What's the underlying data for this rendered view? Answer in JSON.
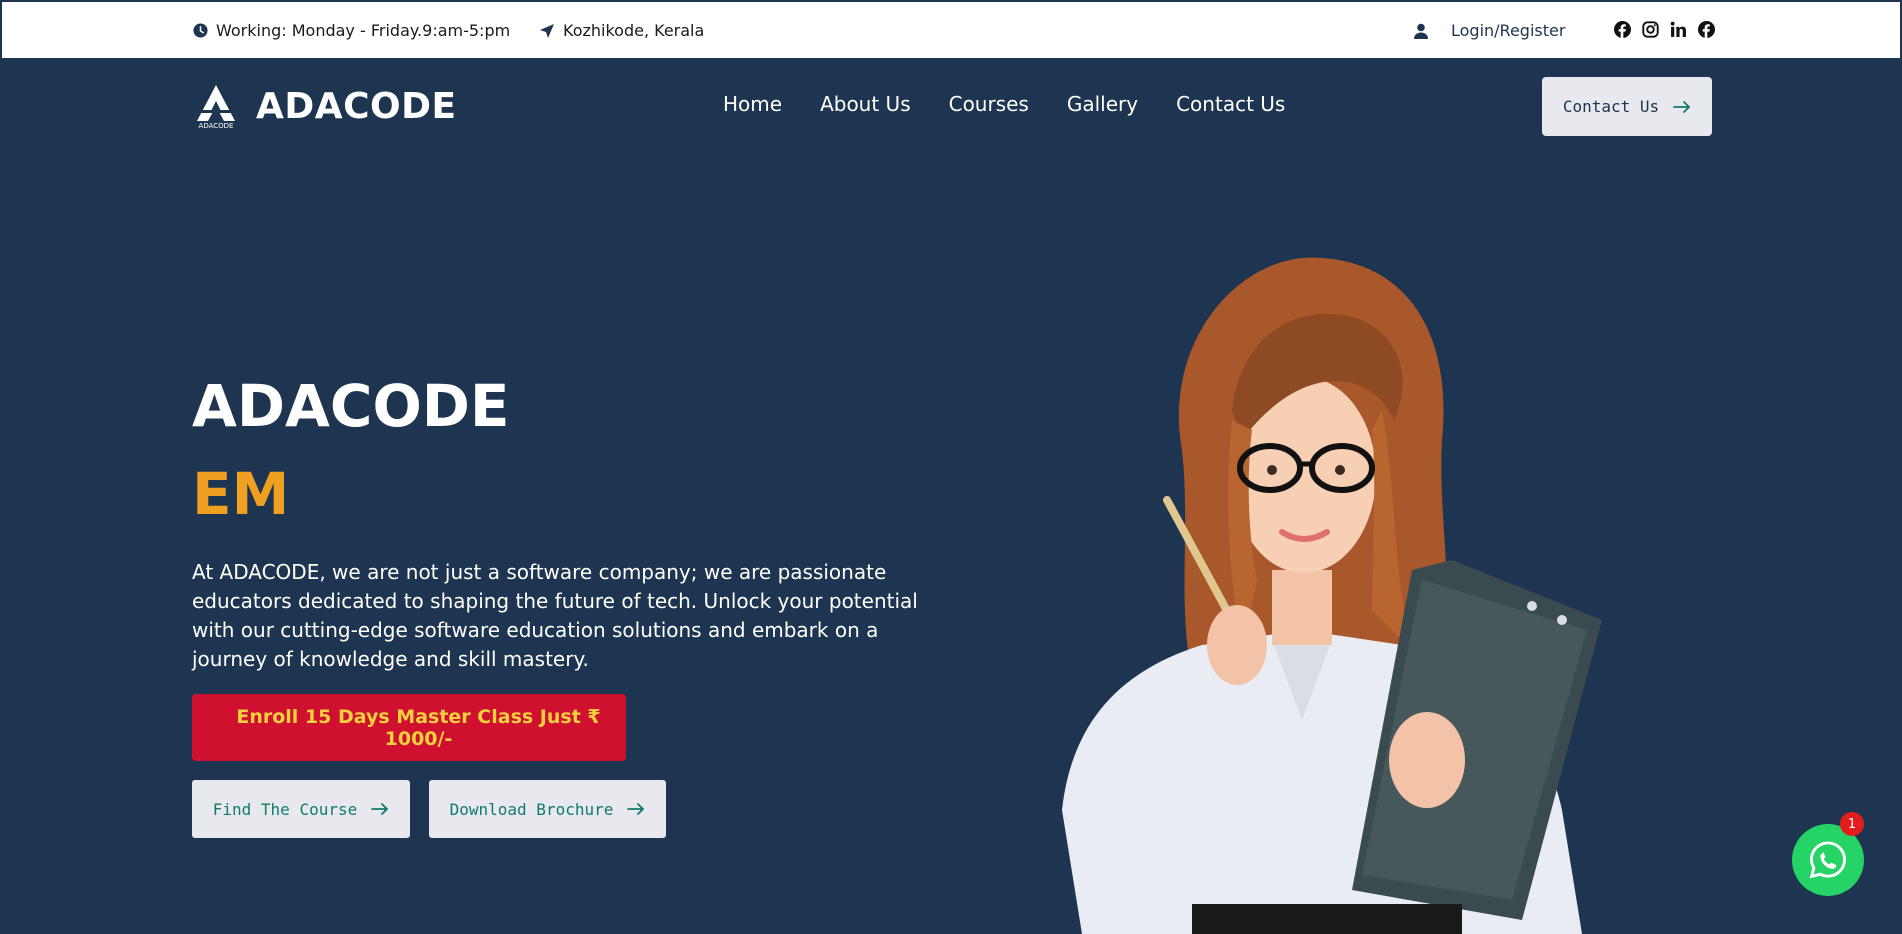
{
  "topbar": {
    "working_hours": "Working: Monday - Friday.9:am-5:pm",
    "location": "Kozhikode, Kerala",
    "login": "Login/Register"
  },
  "nav": {
    "logo_text": "ADACODE",
    "logo_small_text": "ADACODE",
    "items": [
      {
        "label": "Home"
      },
      {
        "label": "About Us"
      },
      {
        "label": "Courses"
      },
      {
        "label": "Gallery"
      },
      {
        "label": "Contact Us"
      }
    ],
    "cta_label": "Contact Us"
  },
  "hero": {
    "title": "ADACODE",
    "subtitle": "EM",
    "description": "At ADACODE, we are not just a software company; we are passionate educators dedicated to shaping the future of tech. Unlock your potential with our cutting-edge software education solutions and embark on a journey of knowledge and skill mastery.",
    "enroll_label": "Enroll 15 Days Master Class Just ₹ 1000/-",
    "find_course_label": "Find The Course",
    "brochure_label": "Download Brochure"
  },
  "whatsapp": {
    "badge_count": "1"
  },
  "colors": {
    "primary": "#1d3550",
    "accent": "#f0a020",
    "enroll_bg": "#d0102f",
    "enroll_text": "#f4d03f",
    "whatsapp": "#25d366"
  },
  "icons": [
    "clock-icon",
    "location-arrow-icon",
    "user-icon",
    "facebook-icon",
    "instagram-icon",
    "linkedin-icon",
    "arrow-right-icon",
    "whatsapp-icon"
  ]
}
